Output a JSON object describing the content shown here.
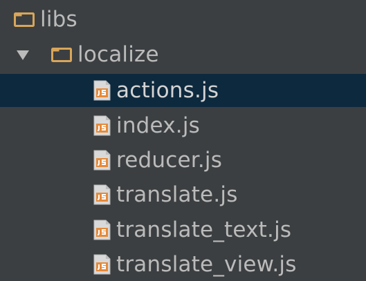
{
  "theme": {
    "panel_background": "#3c3f41",
    "selection_background": "#0d293e",
    "text_color": "#bbbbbb",
    "folder_color": "#d8a65a",
    "js_icon_color": "#e58a3a"
  },
  "tree": {
    "libs_folder": {
      "label": "libs",
      "icon": "folder-icon"
    },
    "localize_folder": {
      "label": "localize",
      "icon": "folder-icon",
      "expanded": true
    },
    "files": [
      {
        "label": "actions.js",
        "icon": "javascript-file-icon",
        "selected": true
      },
      {
        "label": "index.js",
        "icon": "javascript-file-icon",
        "selected": false
      },
      {
        "label": "reducer.js",
        "icon": "javascript-file-icon",
        "selected": false
      },
      {
        "label": "translate.js",
        "icon": "javascript-file-icon",
        "selected": false
      },
      {
        "label": "translate_text.js",
        "icon": "javascript-file-icon",
        "selected": false
      },
      {
        "label": "translate_view.js",
        "icon": "javascript-file-icon",
        "selected": false
      }
    ]
  }
}
